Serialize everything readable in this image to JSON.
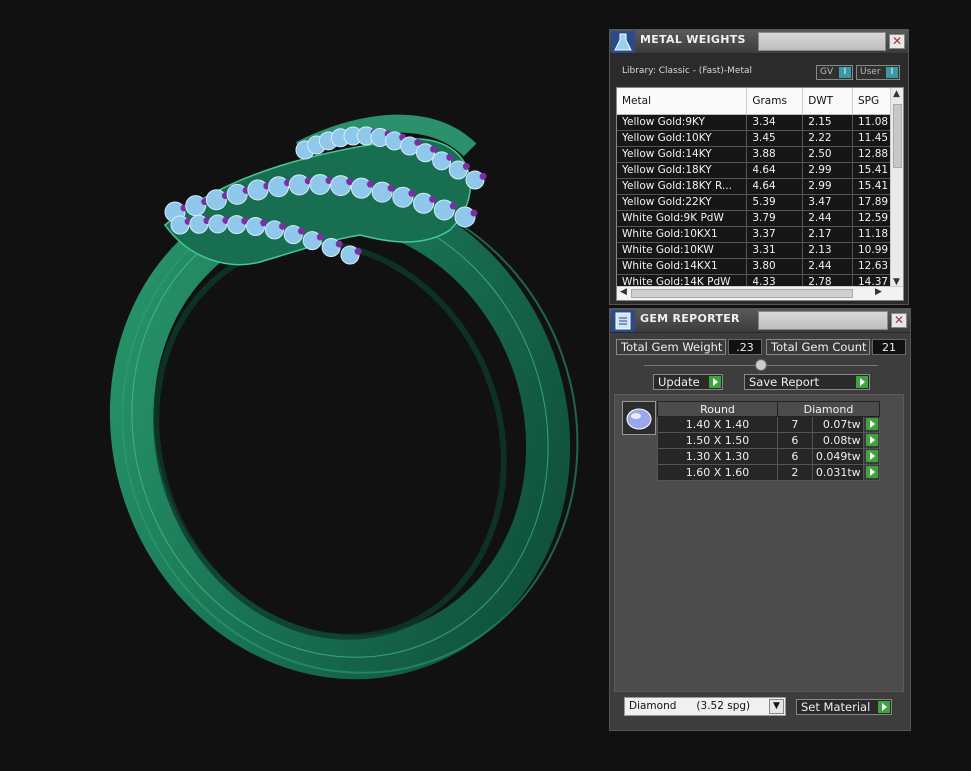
{
  "metal_weights": {
    "title": "METAL WEIGHTS",
    "library_label": "Library: Classic - (Fast)-Metal",
    "toggles": [
      {
        "label": "GV",
        "knob": "I"
      },
      {
        "label": "User",
        "knob": "I"
      }
    ],
    "columns": [
      "Metal",
      "Grams",
      "DWT",
      "SPG"
    ],
    "rows": [
      [
        "Yellow Gold:9KY",
        "3.34",
        "2.15",
        "11.08"
      ],
      [
        "Yellow Gold:10KY",
        "3.45",
        "2.22",
        "11.45"
      ],
      [
        "Yellow Gold:14KY",
        "3.88",
        "2.50",
        "12.88"
      ],
      [
        "Yellow Gold:18KY",
        "4.64",
        "2.99",
        "15.41"
      ],
      [
        "Yellow Gold:18KY R...",
        "4.64",
        "2.99",
        "15.41"
      ],
      [
        "Yellow Gold:22KY",
        "5.39",
        "3.47",
        "17.89"
      ],
      [
        "White Gold:9K PdW",
        "3.79",
        "2.44",
        "12.59"
      ],
      [
        "White Gold:10KX1",
        "3.37",
        "2.17",
        "11.18"
      ],
      [
        "White Gold:10KW",
        "3.31",
        "2.13",
        "10.99"
      ],
      [
        "White Gold:14KX1",
        "3.80",
        "2.44",
        "12.63"
      ],
      [
        "White Gold:14K PdW",
        "4.33",
        "2.78",
        "14.37"
      ]
    ]
  },
  "gem_reporter": {
    "title": "GEM REPORTER",
    "total_weight_label": "Total Gem Weight",
    "total_weight_value": ".23",
    "total_count_label": "Total Gem Count",
    "total_count_value": "21",
    "update_label": "Update",
    "save_report_label": "Save Report",
    "table_headers": [
      "Round",
      "Diamond"
    ],
    "rows": [
      {
        "size": "1.40 X 1.40",
        "count": "7",
        "weight": "0.07tw"
      },
      {
        "size": "1.50 X 1.50",
        "count": "6",
        "weight": "0.08tw"
      },
      {
        "size": "1.30 X 1.30",
        "count": "6",
        "weight": "0.049tw"
      },
      {
        "size": "1.60 X 1.60",
        "count": "2",
        "weight": "0.031tw"
      }
    ],
    "material_select": "Diamond      (3.52 spg)",
    "set_material_label": "Set Material"
  },
  "colors": {
    "ring_metal": "#1f7a58",
    "gem_fill": "#8fc8ea",
    "prong": "#7a2fa6",
    "accent_green": "#3fa43f"
  }
}
